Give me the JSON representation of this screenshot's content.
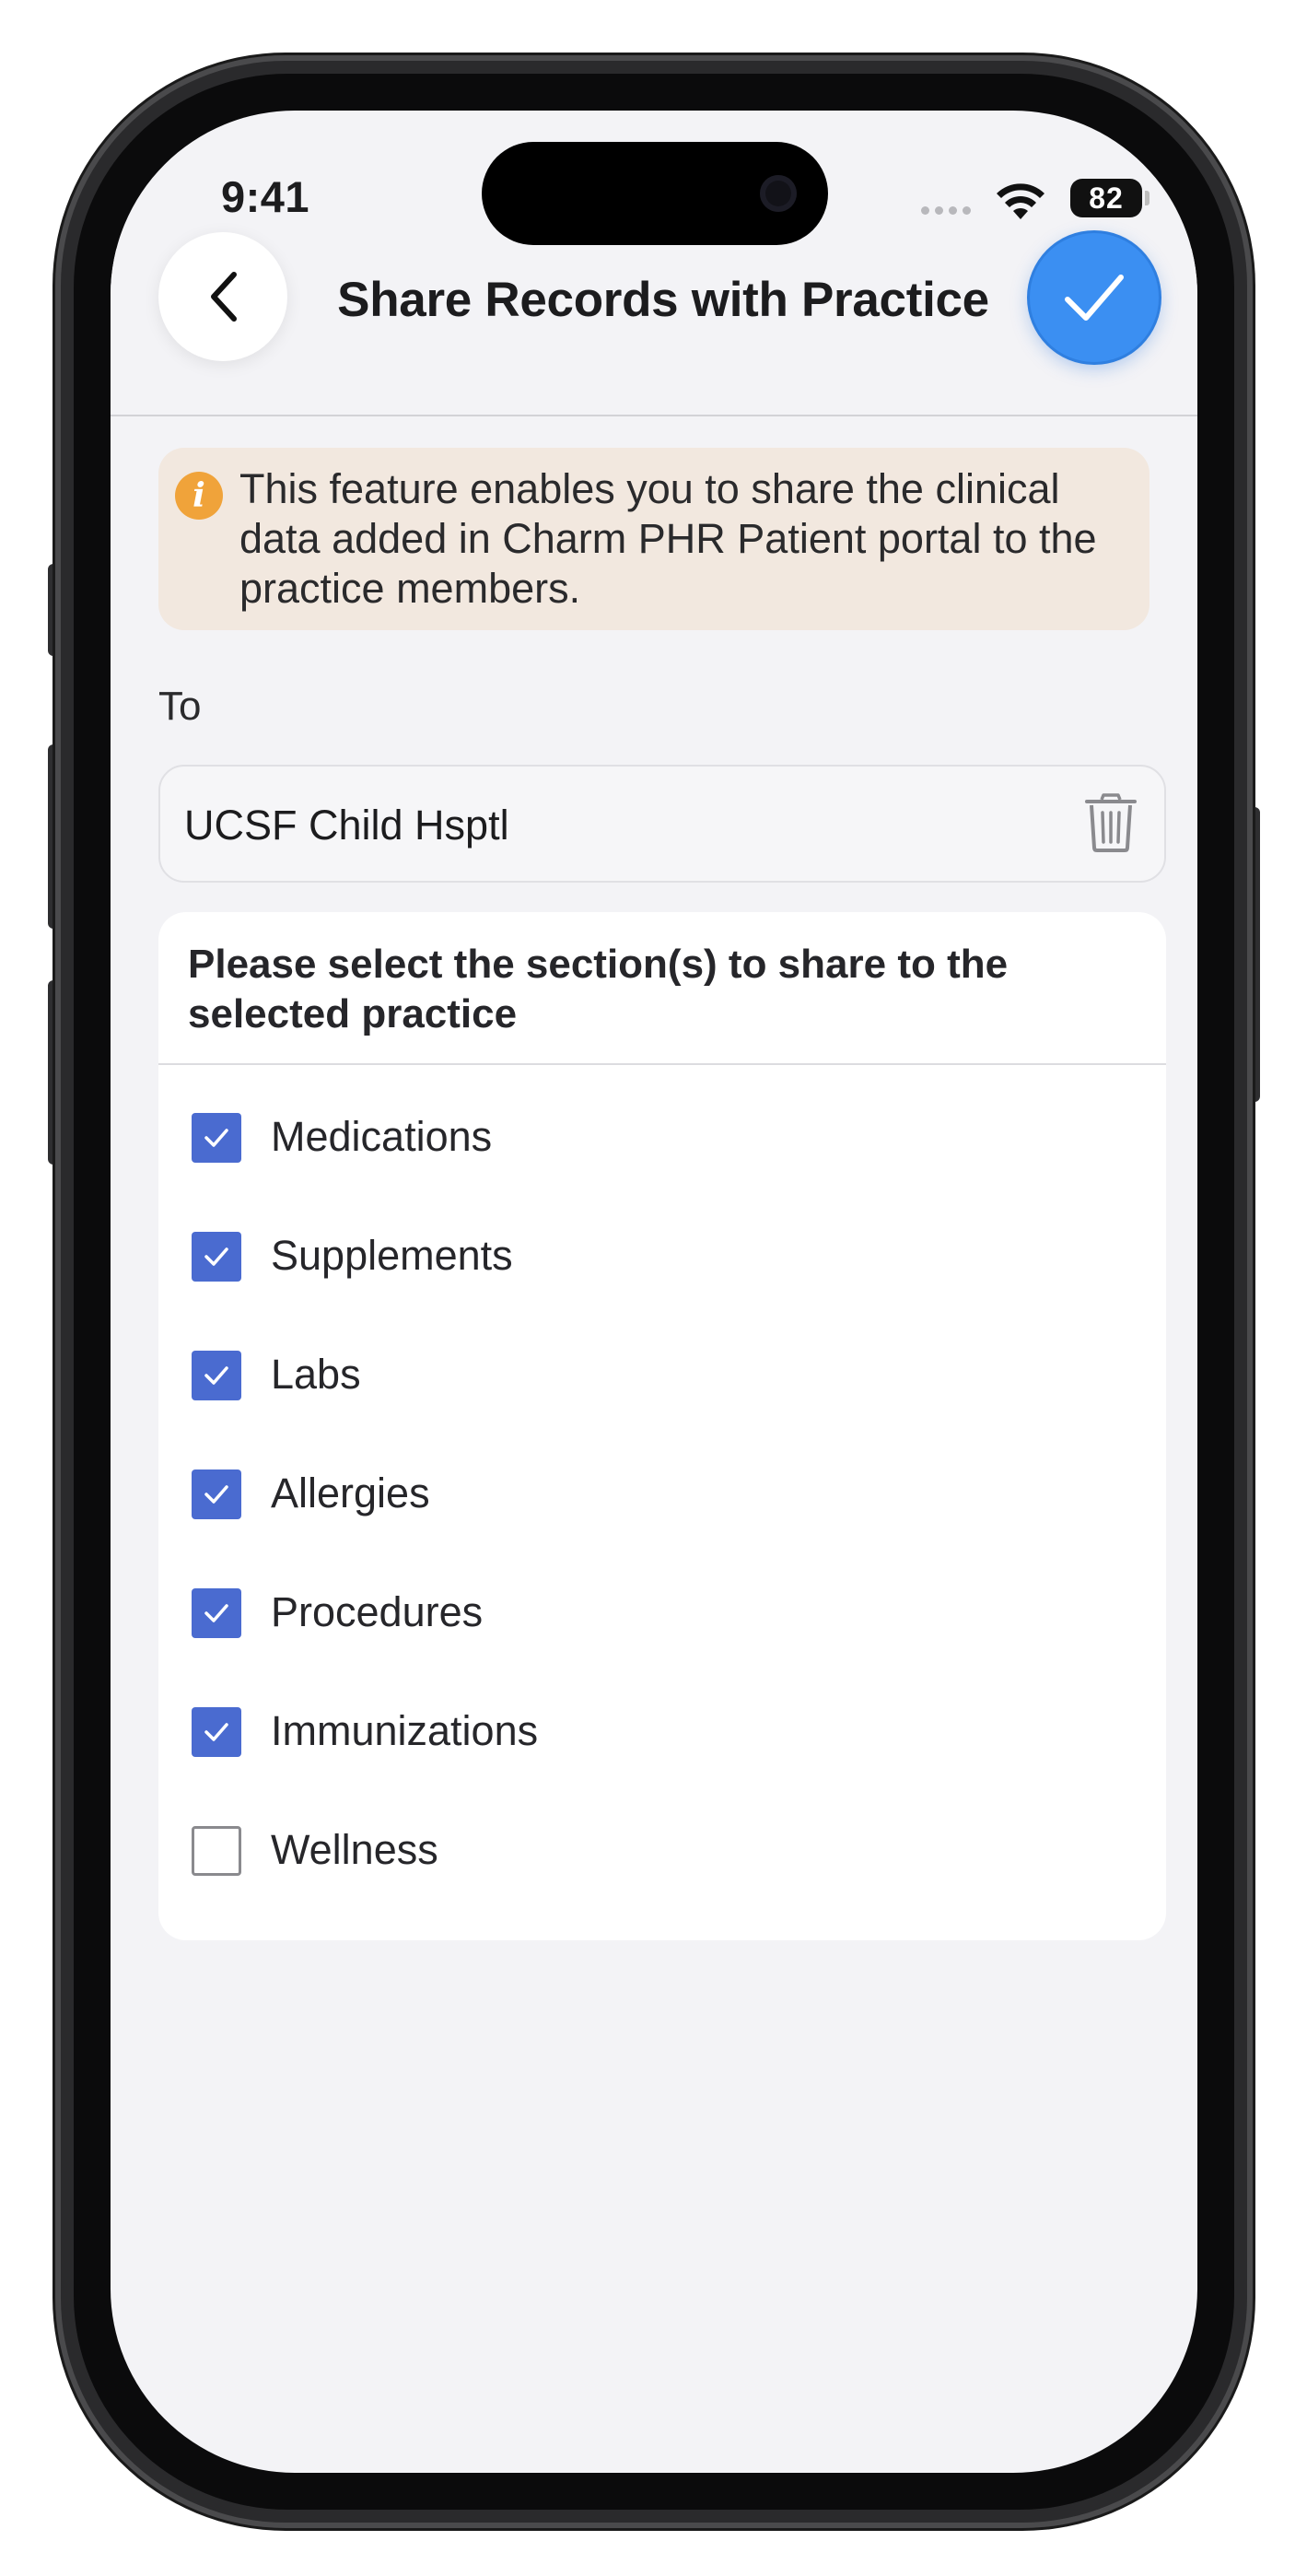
{
  "status_bar": {
    "time": "9:41",
    "battery_level": "82"
  },
  "header": {
    "title": "Share Records with Practice",
    "back_icon": "chevron-left-icon",
    "confirm_icon": "checkmark-icon",
    "confirm_color": "#3b8ff2"
  },
  "info_banner": {
    "icon": "info-icon",
    "text": "This feature enables you to share the clinical data added in Charm PHR Patient portal to the practice members.",
    "background": "#f2e8df",
    "icon_color": "#f0a33a"
  },
  "recipient": {
    "label": "To",
    "value": "UCSF Child Hsptl",
    "delete_icon": "trash-icon"
  },
  "sections": {
    "heading": "Please select the section(s) to share to the selected practice",
    "checkbox_color": "#4a6bd0",
    "items": [
      {
        "label": "Medications",
        "checked": true
      },
      {
        "label": "Supplements",
        "checked": true
      },
      {
        "label": "Labs",
        "checked": true
      },
      {
        "label": "Allergies",
        "checked": true
      },
      {
        "label": "Procedures",
        "checked": true
      },
      {
        "label": "Immunizations",
        "checked": true
      },
      {
        "label": "Wellness",
        "checked": false
      }
    ]
  }
}
